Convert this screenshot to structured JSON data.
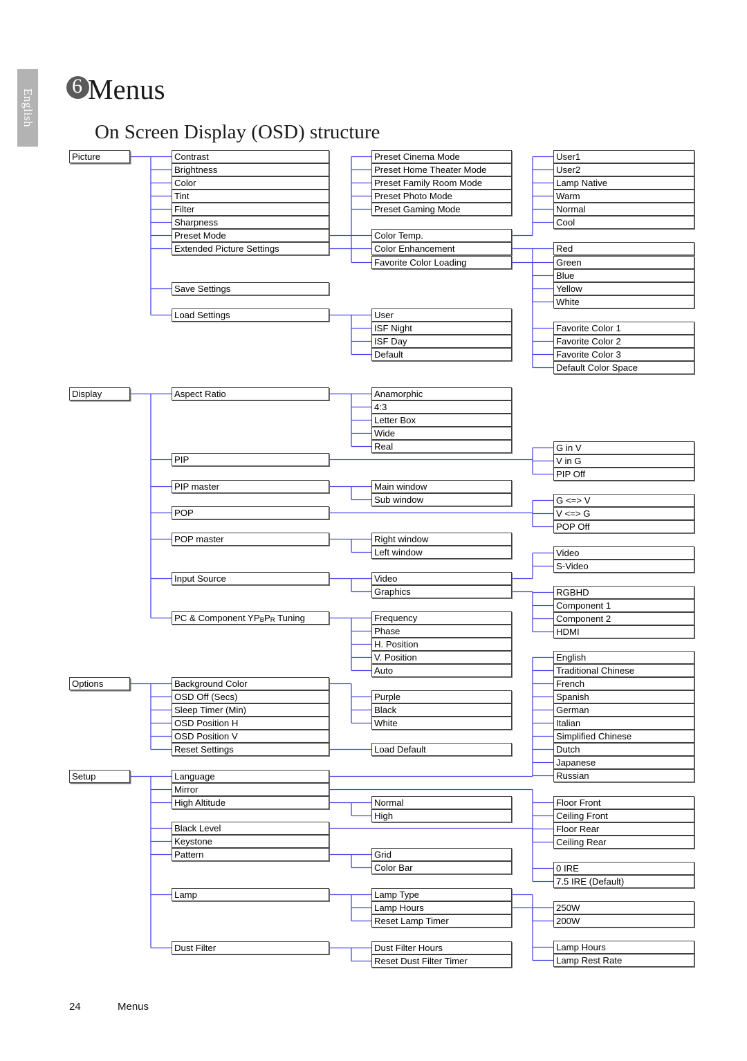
{
  "header": {
    "language_tab": "English",
    "chapter_number": "6",
    "chapter_title": "Menus",
    "section_title": "On Screen Display (OSD) structure"
  },
  "footer": {
    "page_number": "24",
    "label": "Menus"
  },
  "colors": {
    "link": "#4646e6",
    "box_border": "#3f3f3f",
    "tab_background": "#b3b3b3",
    "badge": "#5a5a5a"
  },
  "diagram": {
    "type": "tree",
    "roots": [
      "Picture",
      "Display",
      "Options",
      "Setup"
    ],
    "nodes": {
      "picture": "Picture",
      "contrast": "Contrast",
      "brightness": "Brightness",
      "color": "Color",
      "tint": "Tint",
      "filter": "Filter",
      "sharpness": "Sharpness",
      "preset_mode": "Preset Mode",
      "extended_picture_settings": "Extended Picture Settings",
      "save_settings": "Save Settings",
      "load_settings": "Load Settings",
      "preset_cinema_mode": "Preset Cinema Mode",
      "preset_home_theater_mode": "Preset Home Theater Mode",
      "preset_family_room_mode": "Preset Family Room Mode",
      "preset_photo_mode": "Preset Photo Mode",
      "preset_gaming_mode": "Preset Gaming Mode",
      "color_temp": "Color Temp.",
      "color_enhancement": "Color Enhancement",
      "favorite_color_loading": "Favorite Color Loading",
      "user": "User",
      "isf_night": "ISF Night",
      "isf_day": "ISF Day",
      "default": "Default",
      "user1": "User1",
      "user2": "User2",
      "lamp_native": "Lamp Native",
      "warm": "Warm",
      "normal_ct": "Normal",
      "cool": "Cool",
      "red": "Red",
      "green": "Green",
      "blue": "Blue",
      "yellow": "Yellow",
      "white_ce": "White",
      "favorite_color_1": "Favorite Color 1",
      "favorite_color_2": "Favorite Color 2",
      "favorite_color_3": "Favorite Color 3",
      "default_color_space": "Default Color Space",
      "display": "Display",
      "aspect_ratio": "Aspect Ratio",
      "pip": "PIP",
      "pip_master": "PIP master",
      "pop": "POP",
      "pop_master": "POP master",
      "input_source": "Input Source",
      "pc_component_tuning": "PC & Component YPBPR Tuning",
      "anamorphic": "Anamorphic",
      "four_three": "4:3",
      "letter_box": "Letter Box",
      "wide": "Wide",
      "real": "Real",
      "main_window": "Main window",
      "sub_window": "Sub window",
      "right_window": "Right window",
      "left_window": "Left window",
      "video_src": "Video",
      "graphics": "Graphics",
      "frequency": "Frequency",
      "phase": "Phase",
      "h_position": "H. Position",
      "v_position": "V. Position",
      "auto": "Auto",
      "g_in_v": "G in V",
      "v_in_g": "V in G",
      "pip_off": "PIP Off",
      "g_swap_v": "G <=> V",
      "v_swap_g": "V <=> G",
      "pop_off": "POP Off",
      "video_in": "Video",
      "s_video": "S-Video",
      "rgbhd": "RGBHD",
      "component_1": "Component 1",
      "component_2": "Component 2",
      "hdmi": "HDMI",
      "options": "Options",
      "background_color": "Background Color",
      "osd_off_secs": "OSD Off (Secs)",
      "sleep_timer_min": "Sleep Timer (Min)",
      "osd_position_h": "OSD Position H",
      "osd_position_v": "OSD Position V",
      "reset_settings": "Reset Settings",
      "purple": "Purple",
      "black": "Black",
      "white_bg": "White",
      "load_default": "Load Default",
      "setup": "Setup",
      "language": "Language",
      "mirror": "Mirror",
      "high_altitude": "High Altitude",
      "black_level": "Black Level",
      "keystone": "Keystone",
      "pattern": "Pattern",
      "lamp": "Lamp",
      "dust_filter": "Dust Filter",
      "normal_alt": "Normal",
      "high_alt": "High",
      "grid": "Grid",
      "color_bar": "Color Bar",
      "lamp_type": "Lamp Type",
      "lamp_hours_m": "Lamp Hours",
      "reset_lamp_timer": "Reset Lamp Timer",
      "dust_filter_hours": "Dust Filter Hours",
      "reset_dust_filter_timer": "Reset Dust Filter Timer",
      "lang_english": "English",
      "lang_traditional_chinese": "Traditional Chinese",
      "lang_french": "French",
      "lang_spanish": "Spanish",
      "lang_german": "German",
      "lang_italian": "Italian",
      "lang_simplified_chinese": "Simplified Chinese",
      "lang_dutch": "Dutch",
      "lang_japanese": "Japanese",
      "lang_russian": "Russian",
      "floor_front": "Floor Front",
      "ceiling_front": "Ceiling Front",
      "floor_rear": "Floor Rear",
      "ceiling_rear": "Ceiling Rear",
      "ire_0": "0 IRE",
      "ire_75": "7.5 IRE (Default)",
      "watt_250": "250W",
      "watt_200": "200W",
      "lamp_hours_r": "Lamp Hours",
      "lamp_rest_rate": "Lamp Rest Rate"
    }
  }
}
